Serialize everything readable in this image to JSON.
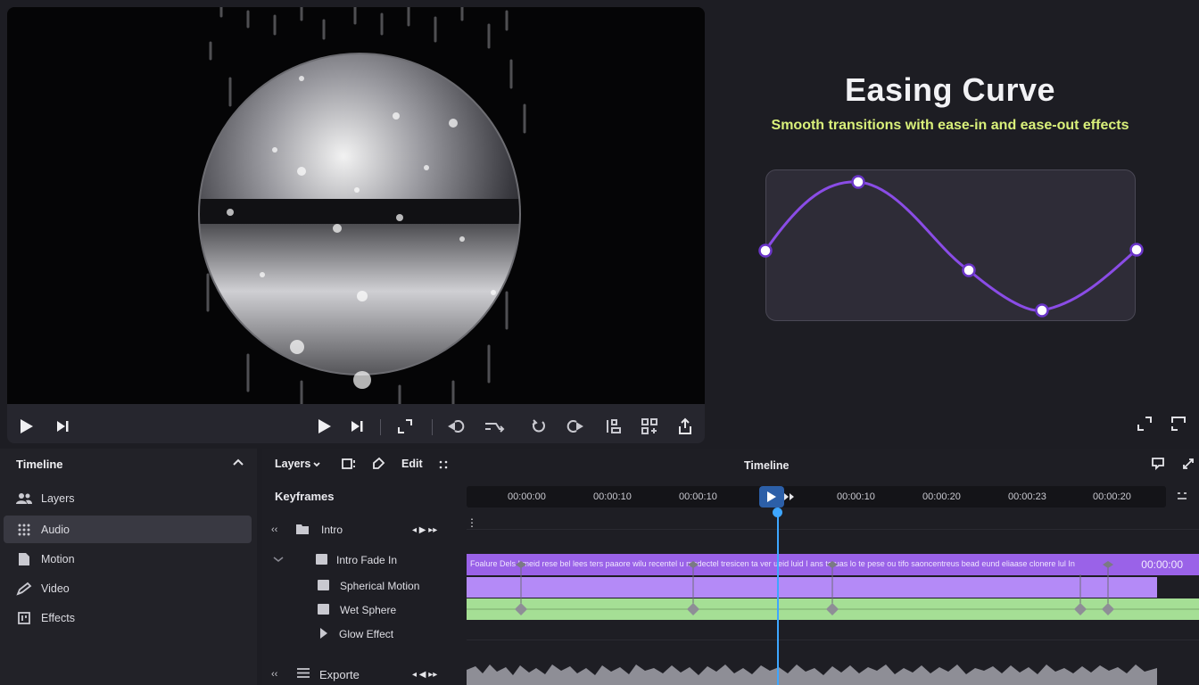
{
  "preview": {
    "controls_left": [
      "play-icon",
      "skip-next-icon"
    ],
    "controls_center": [
      "play-icon",
      "skip-next-icon",
      "crop-icon",
      "undo-icon",
      "swap-icon",
      "rotate-icon",
      "redo-icon",
      "align-icon",
      "grid-icon",
      "export-icon"
    ]
  },
  "info": {
    "title": "Easing Curve",
    "subtitle": "Smooth transitions with ease-in and ease-out effects",
    "accent_color": "#d9f07a",
    "curve_color": "#8a4ce6"
  },
  "sidebar": {
    "heading": "Timeline",
    "items": [
      {
        "label": "Layers",
        "icon": "users-icon",
        "active": false
      },
      {
        "label": "Audio",
        "icon": "grid-dots-icon",
        "active": true
      },
      {
        "label": "Motion",
        "icon": "file-icon",
        "active": false
      },
      {
        "label": "Video",
        "icon": "pen-icon",
        "active": false
      },
      {
        "label": "Effects",
        "icon": "effects-icon",
        "active": false
      }
    ]
  },
  "toolbar": {
    "layers_label": "Layers",
    "edit_label": "Edit",
    "timeline_title": "Timeline"
  },
  "keyframes": {
    "heading": "Keyframes",
    "rows": [
      {
        "label": "Intro"
      },
      {
        "label": "Intro Fade In"
      },
      {
        "label": "Spherical Motion"
      },
      {
        "label": "Wet Sphere"
      },
      {
        "label": "Glow Effect"
      },
      {
        "label": "Exporte"
      }
    ]
  },
  "ruler": {
    "ticks": [
      "00:00:00",
      "00:00:10",
      "00:00:10",
      "00:00:10",
      "00:00:20",
      "00:00:23",
      "00:00:20"
    ]
  },
  "tracks": {
    "purple_text": "Foalure Dels   I meid rese bel lees ters paaore wilu recentel u  modectel tresicen ta   ver ueid luid   I ans teruas lo te pese ou  tifo saoncentreus   bead eund eliaase clonere lul   In",
    "purple_time": "00:00:00",
    "colors": {
      "purple": "#9a62e8",
      "lavender": "#b48af7",
      "green": "#a5df95",
      "playhead": "#3ea6ff"
    }
  }
}
